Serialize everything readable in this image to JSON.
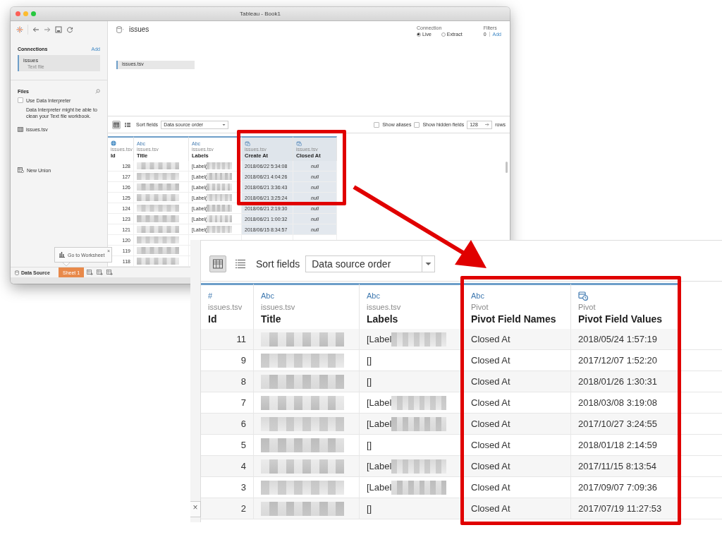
{
  "window": {
    "title": "Tableau - Book1"
  },
  "sidebar": {
    "connections_heading": "Connections",
    "add_link": "Add",
    "connections": [
      {
        "name": "issues",
        "type": "Text file",
        "selected": true
      }
    ],
    "files_heading": "Files",
    "use_data_interpreter": {
      "label": "Use Data Interpreter",
      "checked": false
    },
    "interpreter_note": "Data Interpreter might be able to clean your Text file workbook.",
    "tables": [
      {
        "name": "issues.tsv"
      }
    ],
    "new_union": "New Union"
  },
  "datasource": {
    "name": "issues",
    "connection_label": "Connection",
    "connection_options": [
      {
        "label": "Live",
        "selected": true
      },
      {
        "label": "Extract",
        "selected": false
      }
    ],
    "filters_label": "Filters",
    "filters_count": "0",
    "filters_add": "Add",
    "canvas_tables": [
      "issues.tsv"
    ]
  },
  "grid_toolbar": {
    "grid_view_selected": true,
    "sort_label": "Sort fields",
    "sort_value": "Data source order",
    "show_aliases": {
      "label": "Show aliases",
      "checked": false
    },
    "show_hidden": {
      "label": "Show hidden fields",
      "checked": false
    },
    "rows_value": "128",
    "rows_label": "rows"
  },
  "grid": {
    "columns": [
      {
        "kind": "geo",
        "source": "issues.tsv",
        "name": "Id",
        "selected": false
      },
      {
        "kind": "string",
        "type_label": "Abc",
        "source": "issues.tsv",
        "name": "Title",
        "selected": false
      },
      {
        "kind": "string",
        "type_label": "Abc",
        "source": "issues.tsv",
        "name": "Labels",
        "selected": false
      },
      {
        "kind": "datetime",
        "source": "issues.tsv",
        "name": "Create At",
        "selected": true
      },
      {
        "kind": "datetime",
        "source": "issues.tsv",
        "name": "Closed At",
        "selected": true
      }
    ],
    "rows": [
      {
        "cells": [
          {
            "text": "128"
          },
          {
            "redacted": true
          },
          {
            "text": "[Label(",
            "redacted": true
          },
          {
            "text": "2018/06/22 5:34:08"
          },
          {
            "text": "null",
            "is_null": true
          }
        ]
      },
      {
        "cells": [
          {
            "text": "127"
          },
          {
            "redacted": true
          },
          {
            "text": "[Label(",
            "redacted": true
          },
          {
            "text": "2018/06/21 4:04:26"
          },
          {
            "text": "null",
            "is_null": true
          }
        ]
      },
      {
        "cells": [
          {
            "text": "126"
          },
          {
            "redacted": true
          },
          {
            "text": "[Label(",
            "redacted": true
          },
          {
            "text": "2018/06/21 3:36:43"
          },
          {
            "text": "null",
            "is_null": true
          }
        ]
      },
      {
        "cells": [
          {
            "text": "125"
          },
          {
            "redacted": true
          },
          {
            "text": "[Label(",
            "redacted": true
          },
          {
            "text": "2018/06/21 3:25:24"
          },
          {
            "text": "null",
            "is_null": true
          }
        ]
      },
      {
        "cells": [
          {
            "text": "124"
          },
          {
            "redacted": true
          },
          {
            "text": "[Label(",
            "redacted": true
          },
          {
            "text": "2018/06/21 2:19:30"
          },
          {
            "text": "null",
            "is_null": true
          }
        ]
      },
      {
        "cells": [
          {
            "text": "123"
          },
          {
            "redacted": true
          },
          {
            "text": "[Label(",
            "redacted": true
          },
          {
            "text": "2018/06/21 1:00:32"
          },
          {
            "text": "null",
            "is_null": true
          }
        ]
      },
      {
        "cells": [
          {
            "text": "121"
          },
          {
            "redacted": true
          },
          {
            "text": "[Label(",
            "redacted": true
          },
          {
            "text": "2018/06/15 8:34:57"
          },
          {
            "text": "null",
            "is_null": true
          }
        ]
      },
      {
        "cells": [
          {
            "text": "120"
          },
          {
            "redacted": true
          }
        ]
      },
      {
        "cells": [
          {
            "text": "119"
          },
          {
            "redacted": true
          }
        ]
      },
      {
        "cells": [
          {
            "text": "118"
          },
          {
            "redacted": true
          }
        ]
      }
    ]
  },
  "sheet_tabs": [
    {
      "kind": "datasource",
      "label": "Data Source",
      "selected": false
    },
    {
      "kind": "sheet",
      "label": "Sheet 1",
      "selected": true
    }
  ],
  "tooltip": {
    "text": "Go to Worksheet"
  },
  "inset": {
    "toolbar": {
      "grid_view_selected": true,
      "sort_label": "Sort fields",
      "sort_value": "Data source order"
    },
    "grid": {
      "columns": [
        {
          "kind": "number",
          "type_label": "#",
          "source": "issues.tsv",
          "name": "Id",
          "selected": false
        },
        {
          "kind": "string",
          "type_label": "Abc",
          "source": "issues.tsv",
          "name": "Title",
          "selected": false
        },
        {
          "kind": "string",
          "type_label": "Abc",
          "source": "issues.tsv",
          "name": "Labels",
          "selected": false
        },
        {
          "kind": "string",
          "type_label": "Abc",
          "source": "Pivot",
          "name": "Pivot Field Names",
          "selected": false
        },
        {
          "kind": "datetime",
          "source": "Pivot",
          "name": "Pivot Field Values",
          "selected": false
        }
      ],
      "rows": [
        {
          "cells": [
            {
              "text": "11"
            },
            {
              "redacted": true
            },
            {
              "text": "[Label",
              "redacted": true
            },
            {
              "text": "Closed At"
            },
            {
              "text": "2018/05/24 1:57:19"
            }
          ]
        },
        {
          "cells": [
            {
              "text": "9"
            },
            {
              "redacted": true
            },
            {
              "text": "[]"
            },
            {
              "text": "Closed At"
            },
            {
              "text": "2017/12/07 1:52:20"
            }
          ]
        },
        {
          "cells": [
            {
              "text": "8"
            },
            {
              "redacted": true
            },
            {
              "text": "[]"
            },
            {
              "text": "Closed At"
            },
            {
              "text": "2018/01/26 1:30:31"
            }
          ]
        },
        {
          "cells": [
            {
              "text": "7"
            },
            {
              "redacted": true
            },
            {
              "text": "[Label",
              "redacted": true
            },
            {
              "text": "Closed At"
            },
            {
              "text": "2018/03/08 3:19:08"
            }
          ]
        },
        {
          "cells": [
            {
              "text": "6"
            },
            {
              "redacted": true
            },
            {
              "text": "[Label",
              "redacted": true
            },
            {
              "text": "Closed At"
            },
            {
              "text": "2017/10/27 3:24:55"
            }
          ]
        },
        {
          "cells": [
            {
              "text": "5"
            },
            {
              "redacted": true
            },
            {
              "text": "[]"
            },
            {
              "text": "Closed At"
            },
            {
              "text": "2018/01/18 2:14:59"
            }
          ]
        },
        {
          "cells": [
            {
              "text": "4"
            },
            {
              "redacted": true
            },
            {
              "text": "[Label",
              "redacted": true
            },
            {
              "text": "Closed At"
            },
            {
              "text": "2017/11/15 8:13:54"
            }
          ]
        },
        {
          "cells": [
            {
              "text": "3"
            },
            {
              "redacted": true
            },
            {
              "text": "[Label",
              "redacted": true
            },
            {
              "text": "Closed At"
            },
            {
              "text": "2017/09/07 7:09:36"
            }
          ]
        },
        {
          "cells": [
            {
              "text": "2"
            },
            {
              "redacted": true
            },
            {
              "text": "[]"
            },
            {
              "text": "Closed At"
            },
            {
              "text": "2017/07/19 11:27:53"
            }
          ]
        }
      ]
    },
    "close_glyph": "×"
  }
}
